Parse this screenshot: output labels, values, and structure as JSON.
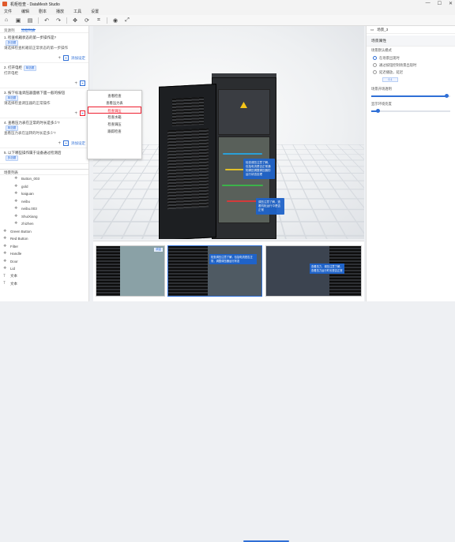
{
  "window": {
    "title": "机柜检查 - DataMesh Studio",
    "controls": [
      "—",
      "☐",
      "✕"
    ]
  },
  "menu": [
    "文件",
    "编辑",
    "剧本",
    "播放",
    "工具",
    "设置"
  ],
  "toolbar_icons": [
    "home-icon",
    "save-icon",
    "undo-icon",
    "redo-icon",
    "move-icon",
    "rotate-icon",
    "crop-icon",
    "camera-icon",
    "maximize-icon"
  ],
  "left_tabs": [
    "资源列",
    "流程列表"
  ],
  "steps": [
    {
      "text": "1. 检查机箱状态的第一步操作是?",
      "badge": "多选题",
      "sub": "请选择检查机箱前正常状态的第一步操作",
      "action": "添加设定"
    },
    {
      "text": "2. 打开电柜",
      "badge": "单选题",
      "sub": "打开电柜",
      "action": ""
    },
    {
      "text": "3. 按下标准调压器面板下面一般的按钮",
      "badge": "单选题",
      "sub": "请选择检查调压器的正常操作",
      "action": ""
    },
    {
      "text": "4. 查看压力表在正常的时长是多少?",
      "badge": "单选题",
      "sub": "查看压力表在运转的时长是多少?",
      "action": "添加设定"
    },
    {
      "text": "5. 以下哪些操作属于设备通过检测后",
      "badge": "多选题",
      "sub": "",
      "action": ""
    }
  ],
  "context_menu": [
    "查看检查",
    "查看压力表",
    "检查调压",
    "检查水箱",
    "检查调压",
    "跟踪检查"
  ],
  "context_highlight_index": 2,
  "tree_header": "场景列表",
  "tree": [
    {
      "label": "Button_003",
      "indent": true,
      "icon": "mesh-icon"
    },
    {
      "label": "gold",
      "indent": true,
      "icon": "mesh-icon"
    },
    {
      "label": "kaiguan",
      "indent": true,
      "icon": "mesh-icon"
    },
    {
      "label": "neibu",
      "indent": true,
      "icon": "mesh-icon"
    },
    {
      "label": "neibu.003",
      "indent": true,
      "icon": "mesh-icon"
    },
    {
      "label": "ShuiXiang",
      "indent": true,
      "icon": "mesh-icon"
    },
    {
      "label": "zhizhen",
      "indent": true,
      "icon": "mesh-icon"
    },
    {
      "label": "Green Button",
      "indent": false,
      "icon": "mesh-icon"
    },
    {
      "label": "Red Button",
      "indent": false,
      "icon": "mesh-icon"
    },
    {
      "label": "Filter",
      "indent": false,
      "icon": "mesh-icon"
    },
    {
      "label": "Handle",
      "indent": false,
      "icon": "mesh-icon"
    },
    {
      "label": "Door",
      "indent": false,
      "icon": "mesh-icon"
    },
    {
      "label": "Lid",
      "indent": false,
      "icon": "mesh-icon"
    },
    {
      "label": "文本",
      "indent": false,
      "icon": "text-icon"
    },
    {
      "label": "文本",
      "indent": false,
      "icon": "text-icon"
    }
  ],
  "viewport": {
    "callout_1": "检查调压注意了解，包括电流是否正常通知调压调整调压器的运行状态处理",
    "callout_2": "调压注意了解，查看机柜运行中是否正常",
    "gizmo": "⚙"
  },
  "thumbs": {
    "label": "调温",
    "thumb2_callout": "检查调压注意了解，包括电流是否正常，调整调压器运行状态",
    "thumb3_callout": "查看压力，调压注意了解，查看压力运行时长是否正常"
  },
  "right_panel": {
    "header": "场景_3",
    "section": "场景属性",
    "row_label": "场景默认模式",
    "radios": [
      {
        "label": "在场景出现时",
        "on": true
      },
      {
        "label": "通过按钮控制场景出现时",
        "on": false
      },
      {
        "label": "延迟播放，延迟",
        "on": false
      }
    ],
    "delay_value": "0.1",
    "slider1_label": "场景开场透明",
    "slider1_value": 0.95,
    "slider2_label": "显示环境亮度",
    "slider2_value": 0.08
  }
}
